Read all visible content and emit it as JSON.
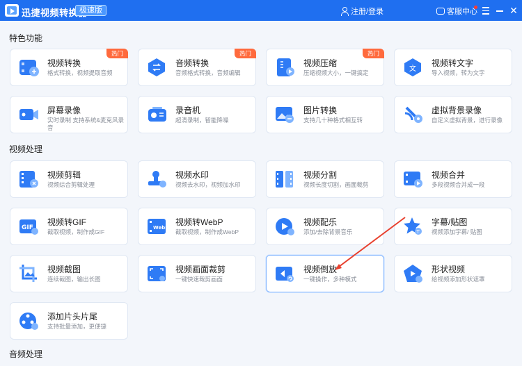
{
  "app": {
    "title": "迅捷视频转换器",
    "edition": "极速版",
    "login": "注册/登录",
    "service": "客服中心",
    "accent": "#1f6ff0"
  },
  "sections": {
    "special": "特色功能",
    "video": "视频处理",
    "audio": "音频处理"
  },
  "cards": {
    "video_convert": {
      "name": "视频转换",
      "desc": "格式转换，视频提取音频",
      "badge": "热门",
      "icon": "film-convert-icon"
    },
    "audio_convert": {
      "name": "音频转换",
      "desc": "音频格式转换，音频编辑",
      "badge": "热门",
      "icon": "audio-convert-icon"
    },
    "video_compress": {
      "name": "视频压缩",
      "desc": "压缩视频大小，一键搞定",
      "badge": "热门",
      "icon": "compress-icon"
    },
    "video_to_text": {
      "name": "视频转文字",
      "desc": "导入视频，转为文字",
      "icon": "text-icon"
    },
    "screen_record": {
      "name": "屏幕录像",
      "desc": "实时录制 支持系统&麦克风录音",
      "icon": "camera-icon"
    },
    "audio_record": {
      "name": "录音机",
      "desc": "超清录制，智能降噪",
      "icon": "recorder-icon"
    },
    "image_convert": {
      "name": "图片转换",
      "desc": "支持几十种格式相互转",
      "icon": "image-icon"
    },
    "virtual_bg": {
      "name": "虚拟背景录像",
      "desc": "自定义虚拟背景，进行录像",
      "icon": "satellite-icon"
    },
    "video_edit": {
      "name": "视频剪辑",
      "desc": "视频综合剪辑处理",
      "icon": "edit-icon"
    },
    "watermark": {
      "name": "视频水印",
      "desc": "视频去水印，视频加水印",
      "icon": "stamp-icon"
    },
    "split": {
      "name": "视频分割",
      "desc": "视频长度切割，画面裁剪",
      "icon": "split-icon"
    },
    "merge": {
      "name": "视频合并",
      "desc": "多段视频合并成一段",
      "icon": "merge-icon"
    },
    "to_gif": {
      "name": "视频转GIF",
      "desc": "截取视频，制作成GIF",
      "icon": "gif-icon"
    },
    "to_webp": {
      "name": "视频转WebP",
      "desc": "截取视频，制作成WebP",
      "icon": "webp-icon"
    },
    "music": {
      "name": "视频配乐",
      "desc": "添加/去除背景音乐",
      "icon": "music-icon"
    },
    "subtitle": {
      "name": "字幕/贴图",
      "desc": "视频添加字幕/ 贴图",
      "icon": "star-icon"
    },
    "screenshot": {
      "name": "视频截图",
      "desc": "连续截图，输出长图",
      "icon": "crop-image-icon"
    },
    "crop": {
      "name": "视频画面裁剪",
      "desc": "一键快速裁剪画面",
      "icon": "frame-crop-icon"
    },
    "reverse": {
      "name": "视频倒放",
      "desc": "一键操作，多种模式",
      "icon": "reverse-icon"
    },
    "shape": {
      "name": "形状视频",
      "desc": "给视频添加形状遮罩",
      "icon": "pentagon-icon"
    },
    "intro_outro": {
      "name": "添加片头片尾",
      "desc": "支持批量添加，更便捷",
      "icon": "film-reel-icon"
    }
  }
}
